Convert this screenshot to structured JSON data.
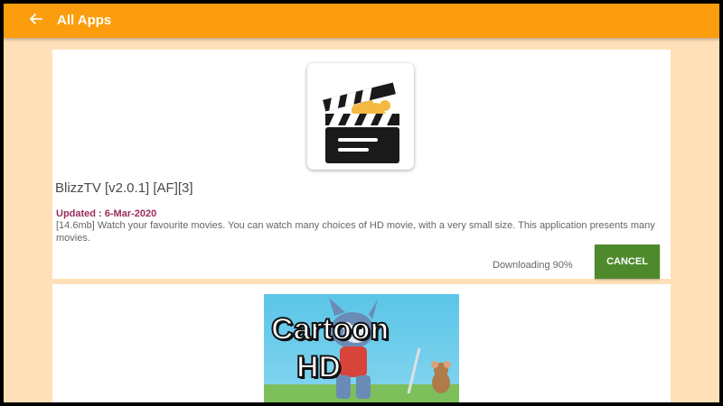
{
  "header": {
    "title": "All Apps",
    "back_icon": "arrow-left-icon"
  },
  "apps": [
    {
      "name": "BlizzTV [v2.0.1] [AF][3]",
      "updated": "Updated : 6-Mar-2020",
      "description": "[14.6mb] Watch your favourite movies. You can watch many choices of HD movie, with a very small size. This application presents many movies.",
      "status": "Downloading 90%",
      "progress_percent": 90,
      "cancel_label": "CANCEL",
      "icon": "clapperboard-icon"
    },
    {
      "thumbnail_text_line1": "Cartoon",
      "thumbnail_text_line2": "HD",
      "icon": "cartoon-thumbnail"
    }
  ],
  "colors": {
    "app_bar": "#fb9d0c",
    "background": "#ffe0b8",
    "updated_text": "#9b2d5c",
    "cancel_button": "#4e8a2c"
  }
}
